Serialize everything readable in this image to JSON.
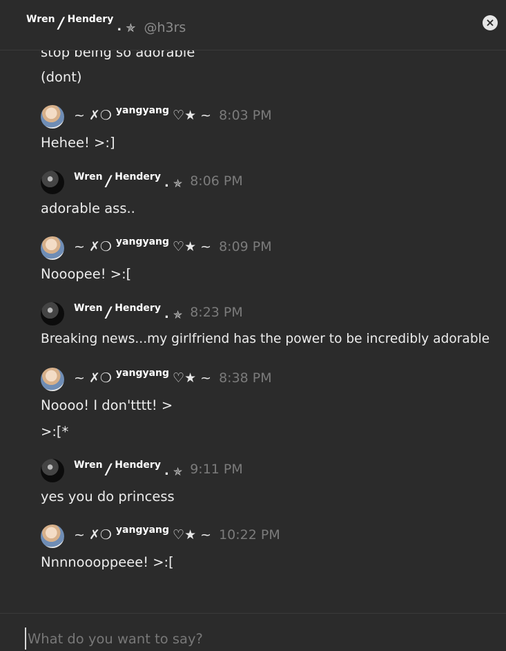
{
  "header": {
    "name_first": "Wren",
    "name_slash": "/",
    "name_second": "Hendery",
    "name_dot": ".",
    "name_star": "✯",
    "handle": "@h3rs",
    "close_icon": "×"
  },
  "partial_lines": [
    "stop being so adorable",
    "(dont)"
  ],
  "users": {
    "yangyang": {
      "prefix": "~ ✗❍",
      "name": "yangyang",
      "suffix": "♡★ ~"
    },
    "wren": {
      "first": "Wren",
      "slash": "/",
      "second": "Hendery",
      "dot": ".",
      "star": "✯"
    }
  },
  "messages": [
    {
      "author": "yangyang",
      "time": "8:03 PM",
      "lines": [
        "Hehee! >:]"
      ]
    },
    {
      "author": "wren",
      "time": "8:06 PM",
      "lines": [
        "adorable ass.."
      ]
    },
    {
      "author": "yangyang",
      "time": "8:09 PM",
      "lines": [
        "Nooopee! >:["
      ]
    },
    {
      "author": "wren",
      "time": "8:23 PM",
      "lines": [
        "Breaking news...my girlfriend has the power to be incredibly adorable"
      ]
    },
    {
      "author": "yangyang",
      "time": "8:38 PM",
      "lines": [
        "Noooo! I don'tttt! >",
        ">:[*"
      ]
    },
    {
      "author": "wren",
      "time": "9:11 PM",
      "lines": [
        "yes you do princess"
      ]
    },
    {
      "author": "yangyang",
      "time": "10:22 PM",
      "lines": [
        "Nnnnoooppeee! >:["
      ]
    }
  ],
  "composer": {
    "placeholder": "What do you want to say?"
  }
}
